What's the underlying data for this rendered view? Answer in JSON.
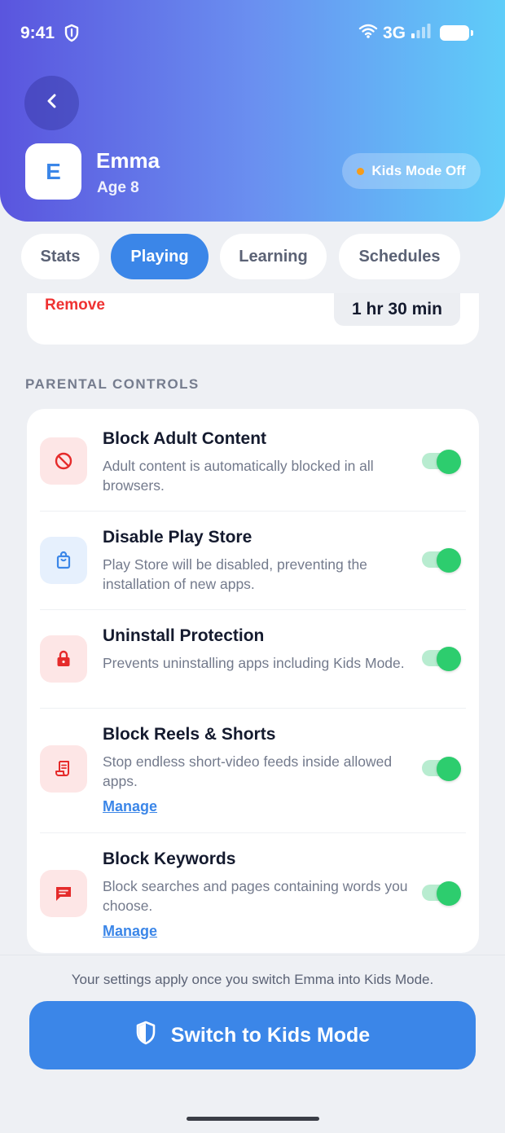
{
  "status_bar": {
    "time": "9:41",
    "network": "3G"
  },
  "profile": {
    "initial": "E",
    "name": "Emma",
    "age": "Age 8",
    "mode_status": "Kids Mode Off"
  },
  "tabs": [
    {
      "label": "Stats",
      "active": false
    },
    {
      "label": "Playing",
      "active": true
    },
    {
      "label": "Learning",
      "active": false
    },
    {
      "label": "Schedules",
      "active": false
    }
  ],
  "limit_card": {
    "remove_label": "Remove",
    "duration": "1 hr 30 min"
  },
  "parental_controls": {
    "section_title": "PARENTAL CONTROLS",
    "items": [
      {
        "title": "Block Adult Content",
        "description": "Adult content is automatically blocked in all browsers.",
        "icon": "block-icon",
        "enabled": true
      },
      {
        "title": "Disable Play Store",
        "description": "Play Store will be disabled, preventing the installation of new apps.",
        "icon": "shopping-bag-icon",
        "enabled": true
      },
      {
        "title": "Uninstall Protection",
        "description": "Prevents uninstalling apps including Kids Mode.",
        "icon": "lock-icon",
        "enabled": true
      },
      {
        "title": "Block Reels & Shorts",
        "description": "Stop endless short-video feeds inside allowed apps.",
        "manage_label": "Manage",
        "icon": "scroll-icon",
        "enabled": true
      },
      {
        "title": "Block Keywords",
        "description": "Block searches and pages containing words you choose.",
        "manage_label": "Manage",
        "icon": "message-icon",
        "enabled": true
      }
    ]
  },
  "footer": {
    "note": "Your settings apply once you switch Emma into Kids Mode.",
    "button_label": "Switch to Kids Mode"
  },
  "colors": {
    "accent": "#3b86e8",
    "danger": "#ef3232",
    "toggle_on": "#2dcd6e",
    "status_dot": "#f59c1a"
  }
}
